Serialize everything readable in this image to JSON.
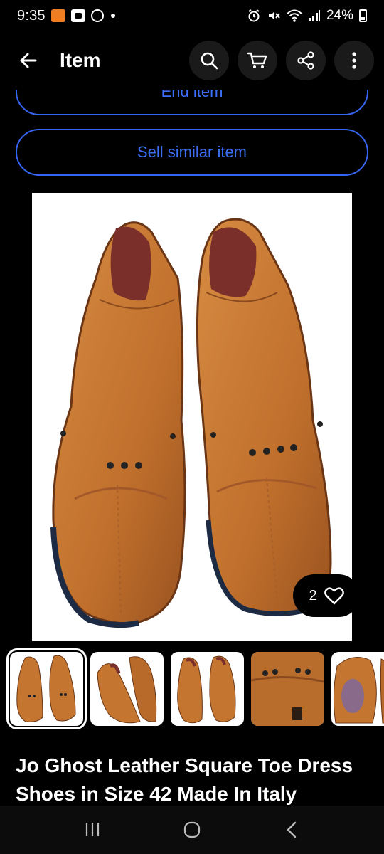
{
  "status": {
    "time": "9:35",
    "battery": "24%"
  },
  "appbar": {
    "title": "Item",
    "back_icon": "arrow-left-icon",
    "actions": [
      "search-icon",
      "cart-icon",
      "share-icon",
      "more-vertical-icon"
    ]
  },
  "buttons": {
    "end_item": "End item",
    "sell_similar": "Sell similar item"
  },
  "gallery": {
    "like_count": "2",
    "thumbnail_count": 5,
    "selected_index": 0
  },
  "item": {
    "title": "Jo Ghost Leather Square Toe Dress Shoes in Size 42 Made In Italy"
  },
  "colors": {
    "accent": "#3665f3",
    "background": "#000000",
    "leather": "#c97a35"
  }
}
